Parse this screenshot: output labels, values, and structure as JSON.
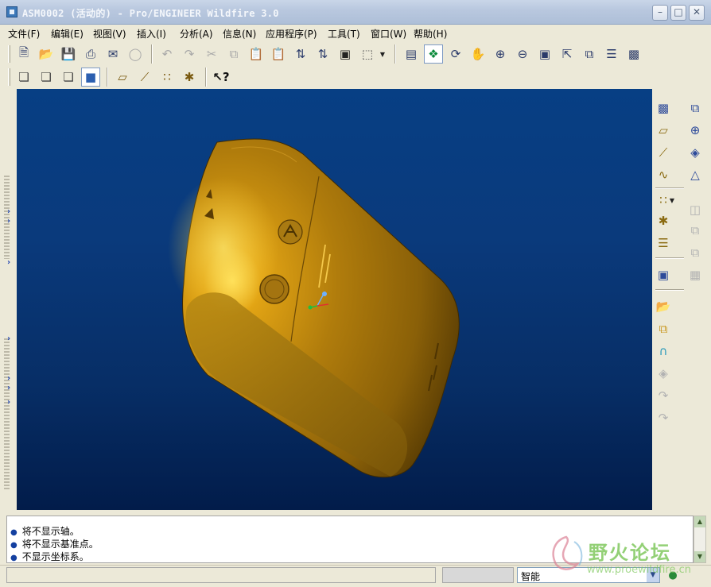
{
  "window": {
    "title": "ASM0002 (活动的) - Pro/ENGINEER Wildfire 3.0",
    "buttons": [
      "minimize-button",
      "maximize-button",
      "close-button"
    ]
  },
  "menubar": {
    "items": [
      {
        "label": "文件(F)"
      },
      {
        "label": "编辑(E)"
      },
      {
        "label": "视图(V)"
      },
      {
        "label": "插入(I)"
      },
      {
        "label": "分析(A)"
      },
      {
        "label": "信息(N)"
      },
      {
        "label": "应用程序(P)"
      },
      {
        "label": "工具(T)"
      },
      {
        "label": "窗口(W)"
      },
      {
        "label": "帮助(H)"
      }
    ]
  },
  "toolbar": {
    "row1_icons": [
      "new-file-icon",
      "open-folder-icon",
      "save-icon",
      "print-icon",
      "send-mail-icon",
      "close-window-icon",
      "undo-icon",
      "redo-icon",
      "cut-icon",
      "copy-icon",
      "paste-icon",
      "paste-special-icon",
      "regenerate-icon",
      "regen-manager-icon",
      "find-icon",
      "selection-box-icon",
      "repaint-icon",
      "spin-center-icon",
      "orient-mode-icon",
      "pan-icon",
      "zoom-in-icon",
      "zoom-out-icon",
      "refit-icon",
      "reorient-icon",
      "saved-views-icon",
      "layers-icon",
      "view-manager-icon"
    ],
    "row2_icons": [
      "wireframe-icon",
      "hidden-line-icon",
      "no-hidden-icon",
      "shading-icon",
      "datum-planes-icon",
      "datum-axes-icon",
      "datum-points-icon",
      "coordinate-systems-icon",
      "context-help-icon"
    ]
  },
  "right_toolbar": {
    "icons": [
      "datum-plane-tool-icon",
      "datum-axis-tool-icon",
      "datum-curve-tool-icon",
      "datum-point-tool-icon",
      "coordinate-system-tool-icon",
      "analysis-feature-icon",
      "sketch-tool-icon",
      "component-assemble-icon",
      "component-create-icon",
      "pattern-icon",
      "mirror-icon",
      "merge-icon",
      "trim-icon",
      "round-icon",
      "chamfer-icon",
      "extrude-icon",
      "revolve-icon",
      "sweep-icon",
      "blend-icon",
      "shell-icon",
      "draft-icon",
      "table-icon"
    ]
  },
  "messages": [
    {
      "text": "将不显示轴。"
    },
    {
      "text": "将不显示基准点。"
    },
    {
      "text": "不显示坐标系。"
    }
  ],
  "statusbar": {
    "filter_value": "智能"
  },
  "watermark": {
    "text": "野火论坛",
    "url": "www.proewildfire.cn"
  },
  "colors": {
    "viewport_top": "#073f84",
    "viewport_bottom": "#021c4a",
    "model_gold": "#c08a10",
    "model_shadow": "#5a3e04",
    "highlight": "#ffd23a"
  }
}
